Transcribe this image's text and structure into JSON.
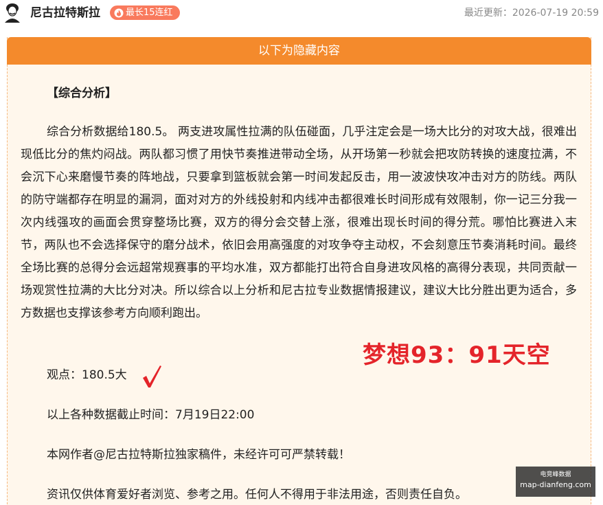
{
  "header": {
    "author": "尼古拉特斯拉",
    "streak_badge": "最长15连红",
    "updated": "最近更新：2026-07-19 20:59"
  },
  "hidden_bar": {
    "label": "以下为隐藏内容"
  },
  "article": {
    "section_title": "【综合分析】",
    "analysis": "综合分析数据给180.5。 两支进攻属性拉满的队伍碰面，几乎注定会是一场大比分的对攻大战，很难出现低比分的焦灼闷战。两队都习惯了用快节奏推进带动全场，从开场第一秒就会把攻防转换的速度拉满，不会沉下心来磨慢节奏的阵地战，只要拿到篮板就会第一时间发起反击，用一波波快攻冲击对方的防线。两队的防守端都存在明显的漏洞，面对对方的外线投射和内线冲击都很难长时间形成有效限制，你一记三分我一次内线强攻的画面会贯穿整场比赛，双方的得分会交替上涨，很难出现长时间的得分荒。哪怕比赛进入末节，两队也不会选择保守的磨分战术，依旧会用高强度的对攻争夺主动权，不会刻意压节奏消耗时间。最终全场比赛的总得分会远超常规赛事的平均水准，双方都能打出符合自身进攻风格的高得分表现，共同贡献一场观赏性拉满的大比分对决。所以综合以上分析和尼古拉专业数据情报建议，建议大比分胜出更为适合，多方数据也支撑该参考方向顺利跑出。",
    "view": "观点：180.5大",
    "cutoff": "以上各种数据截止时间：7月19日22:00",
    "copyright": "本网作者@尼古拉特斯拉独家稿件，未经许可可严禁转载！",
    "disclaimer": "资讯仅供体育爱好者浏览、参考之用。任何人不得用于非法用途，否则责任自负。"
  },
  "overlay": {
    "score_text": "梦想93：91天空",
    "badge_cn": "电竞峰数据",
    "badge_url": "map-dianfeng.com"
  },
  "colors": {
    "accent": "#f48a2c",
    "streak": "#f97a5d",
    "watermark": "#e4242a",
    "check": "#e4242a"
  },
  "icons": {
    "avatar": "avatar-portrait-icon",
    "flame": "flame-icon",
    "check": "checkmark-icon"
  }
}
